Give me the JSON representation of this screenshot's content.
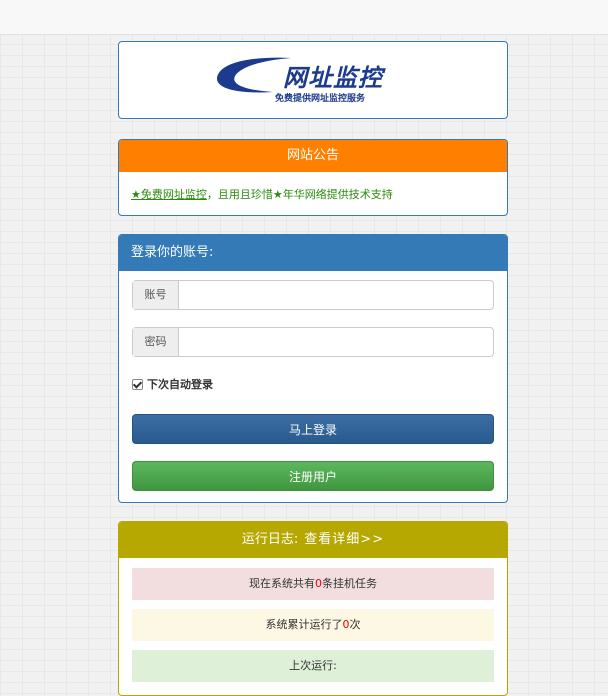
{
  "logo": {
    "title": "网址监控",
    "subtitle": "免费提供网址监控服务"
  },
  "notice": {
    "header": "网站公告",
    "text_link": "★免费网址监控",
    "text_rest": "，且用且珍惜★年华网络提供技术支持"
  },
  "login": {
    "header": "登录你的账号:",
    "username_label": "账号",
    "username_value": "",
    "password_label": "密码",
    "password_value": "",
    "remember_label": "下次自动登录",
    "remember_checked": true,
    "login_button": "马上登录",
    "register_button": "注册用户"
  },
  "log": {
    "header": "运行日志:",
    "detail_link": "查看详细>>",
    "tasks_prefix": "现在系统共有",
    "tasks_count": "0",
    "tasks_suffix": "条挂机任务",
    "runs_prefix": "系统累计运行了",
    "runs_count": "0",
    "runs_suffix": "次",
    "last_run": "上次运行:"
  },
  "colors": {
    "notice_header": "#ff8000",
    "login_header": "#337ab7",
    "log_header": "#b6a800",
    "login_button": "#285a8e",
    "register_button": "#5cb85c"
  }
}
